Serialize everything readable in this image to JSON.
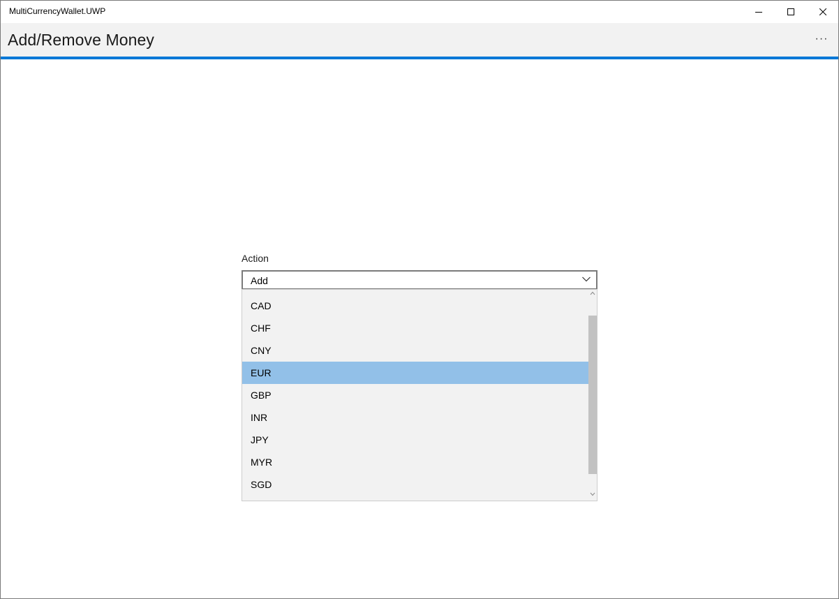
{
  "window": {
    "title": "MultiCurrencyWallet.UWP",
    "controls": {
      "minimize": "minimize-icon",
      "maximize": "maximize-icon",
      "close": "close-icon"
    }
  },
  "appbar": {
    "page_title": "Add/Remove Money",
    "more_label": "···"
  },
  "form": {
    "action_label": "Action",
    "action_selected": "Add",
    "currency_options": [
      "CAD",
      "CHF",
      "CNY",
      "EUR",
      "GBP",
      "INR",
      "JPY",
      "MYR",
      "SGD"
    ],
    "highlighted_option": "EUR"
  },
  "colors": {
    "accent": "#0078d7",
    "highlight": "#92c0e8",
    "appbar_bg": "#f2f2f2"
  }
}
